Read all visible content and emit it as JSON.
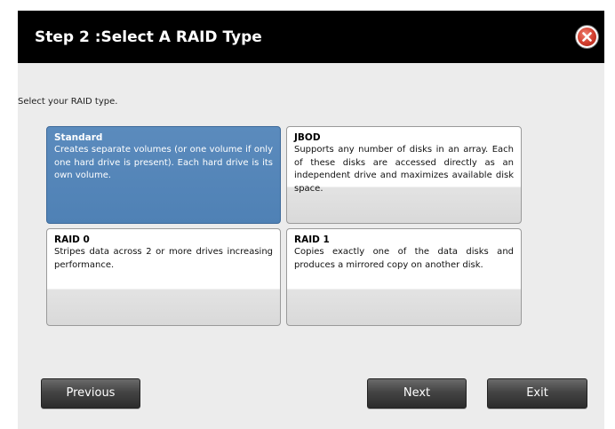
{
  "dialog": {
    "title": "Step 2 :Select A RAID Type",
    "close_icon": "close-icon",
    "close_color": "#d03c2c",
    "prompt": "Select your RAID type."
  },
  "raid_options": [
    {
      "title": "Standard",
      "description": "Creates separate volumes (or one volume if only one hard drive is present). Each hard drive is its own volume.",
      "selected": true
    },
    {
      "title": "JBOD",
      "description": "Supports any number of disks in an array. Each of these disks are accessed directly as an independent drive and maximizes available disk space.",
      "selected": false
    },
    {
      "title": "RAID 0",
      "description": "Stripes data across 2 or more drives increasing performance.",
      "selected": false
    },
    {
      "title": "RAID 1",
      "description": "Copies exactly one of the data disks and produces a mirrored copy on another disk.",
      "selected": false
    }
  ],
  "buttons": {
    "previous": "Previous",
    "next": "Next",
    "exit": "Exit"
  },
  "colors": {
    "titlebar": "#000000",
    "selected_card": "#4f81b5",
    "button": "#444444"
  }
}
